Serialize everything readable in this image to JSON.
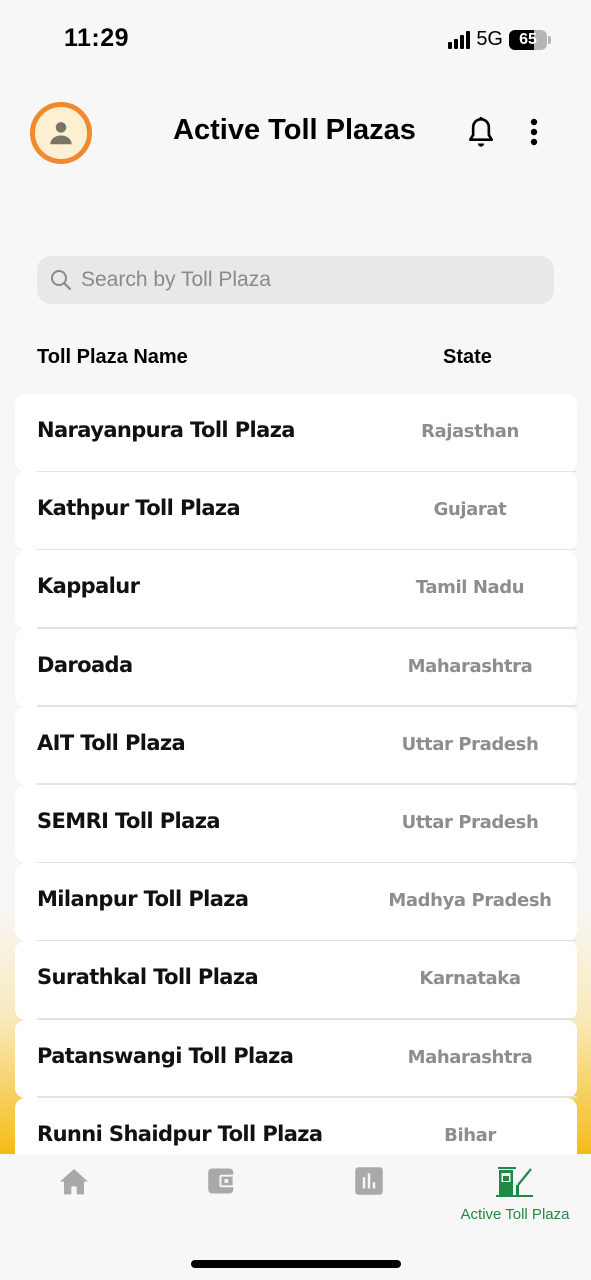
{
  "status_bar": {
    "time": "11:29",
    "network": "5G",
    "battery_percent": 65,
    "battery_label": "65",
    "signal_bars_active": 2,
    "signal_bars_total": 4
  },
  "header": {
    "title": "Active Toll Plazas",
    "avatar_icon": "user-icon",
    "notification_icon": "bell-icon",
    "menu_icon": "more-vertical-icon"
  },
  "search": {
    "placeholder": "Search by Toll Plaza",
    "value": "",
    "icon": "search-icon"
  },
  "table": {
    "columns": [
      "Toll Plaza Name",
      "State"
    ],
    "rows": [
      {
        "name": "Narayanpura Toll Plaza",
        "state": "Rajasthan"
      },
      {
        "name": "Kathpur Toll Plaza",
        "state": "Gujarat"
      },
      {
        "name": "Kappalur",
        "state": "Tamil Nadu"
      },
      {
        "name": "Daroada",
        "state": "Maharashtra"
      },
      {
        "name": "AIT Toll Plaza",
        "state": "Uttar Pradesh"
      },
      {
        "name": "SEMRI Toll Plaza",
        "state": "Uttar Pradesh"
      },
      {
        "name": "Milanpur Toll Plaza",
        "state": "Madhya Pradesh"
      },
      {
        "name": "Surathkal Toll Plaza",
        "state": "Karnataka"
      },
      {
        "name": "Patanswangi Toll Plaza",
        "state": "Maharashtra"
      },
      {
        "name": "Runni Shaidpur Toll Plaza",
        "state": "Bihar"
      }
    ]
  },
  "tab_bar": {
    "tabs": [
      {
        "icon": "home-icon",
        "label": "",
        "active": false
      },
      {
        "icon": "wallet-icon",
        "label": "",
        "active": false
      },
      {
        "icon": "bar-chart-icon",
        "label": "",
        "active": false
      },
      {
        "icon": "toll-booth-icon",
        "label": "Active Toll Plaza",
        "active": true
      }
    ]
  },
  "colors": {
    "accent_green": "#1e8a45",
    "avatar_ring": "#ef8a2f",
    "inactive_icon": "#a9a9a9",
    "state_text": "#8d8d8d"
  }
}
